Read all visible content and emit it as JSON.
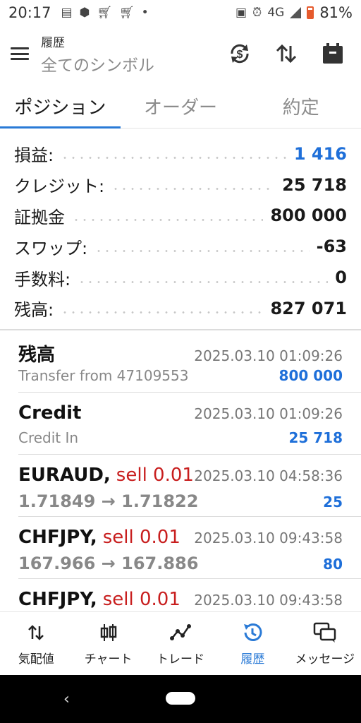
{
  "status": {
    "time": "20:17",
    "network": "4G",
    "battery": "81%"
  },
  "appbar": {
    "title": "履歴",
    "subtitle": "全てのシンボル"
  },
  "tabs": [
    {
      "label": "ポジション",
      "active": true
    },
    {
      "label": "オーダー",
      "active": false
    },
    {
      "label": "約定",
      "active": false
    }
  ],
  "summary": {
    "profit": {
      "label": "損益:",
      "value": "1 416"
    },
    "credit": {
      "label": "クレジット:",
      "value": "25 718"
    },
    "deposit": {
      "label": "証拠金",
      "value": "800 000"
    },
    "swap": {
      "label": "スワップ:",
      "value": "-63"
    },
    "commission": {
      "label": "手数料:",
      "value": "0"
    },
    "balance": {
      "label": "残高:",
      "value": "827 071"
    }
  },
  "history": [
    {
      "title": "残高",
      "time": "2025.03.10 01:09:26",
      "sub": "Transfer from 47109553",
      "amount": "800 000"
    },
    {
      "title": "Credit",
      "time": "2025.03.10 01:09:26",
      "sub": "Credit In",
      "amount": "25 718"
    },
    {
      "symbol": "EURAUD,",
      "side": "sell 0.01",
      "time": "2025.03.10 04:58:36",
      "prices": "1.71849 → 1.71822",
      "amount": "25"
    },
    {
      "symbol": "CHFJPY,",
      "side": "sell 0.01",
      "time": "2025.03.10 09:43:58",
      "prices": "167.966 → 167.886",
      "amount": "80"
    },
    {
      "symbol": "CHFJPY,",
      "side": "sell 0.01",
      "time": "2025.03.10 09:43:58"
    }
  ],
  "bottomnav": [
    {
      "label": "気配値",
      "icon": "quotes-arrows-icon"
    },
    {
      "label": "チャート",
      "icon": "candlestick-icon"
    },
    {
      "label": "トレード",
      "icon": "trade-line-icon"
    },
    {
      "label": "履歴",
      "icon": "history-clock-icon",
      "active": true
    },
    {
      "label": "メッセージ",
      "icon": "messages-icon"
    }
  ],
  "colors": {
    "accent": "#2a7ad6",
    "profit_blue": "#1e6fd9",
    "sell_red": "#c81e1e"
  }
}
